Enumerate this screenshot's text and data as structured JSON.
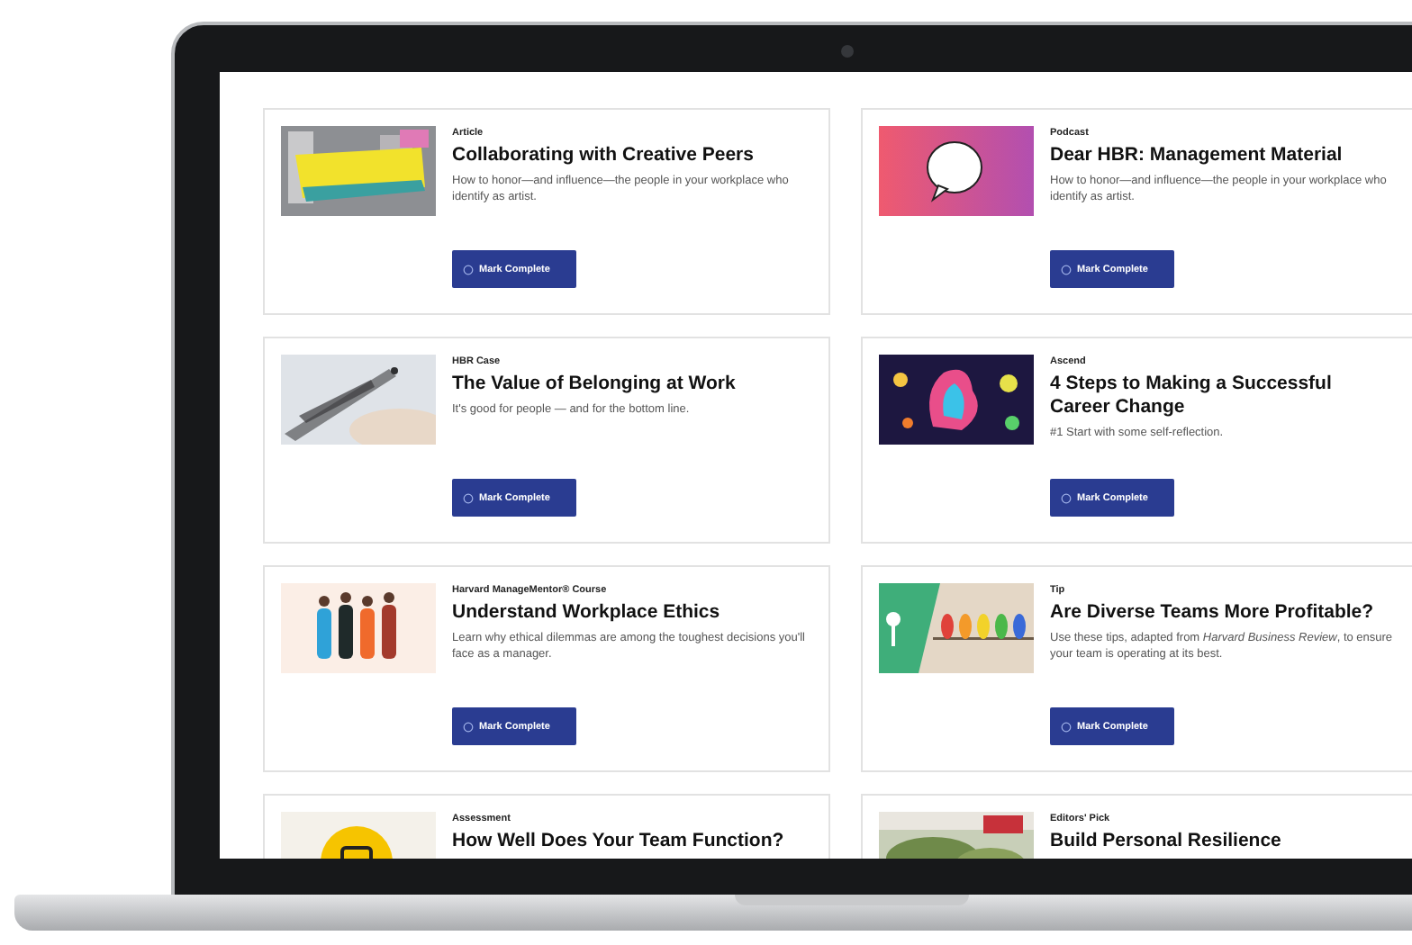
{
  "cards": [
    {
      "kind": "picture",
      "label": "Article",
      "title": "Collaborating with Creative Peers",
      "description": "How to honor—and influence—the people in your workplace who identify as artist.",
      "button": "Mark Complete"
    },
    {
      "kind": "picture",
      "label": "Podcast",
      "title": "Dear HBR: Management Material",
      "description": "How to honor—and influence—the people in your workplace who identify as artist.",
      "button": "Mark Complete"
    },
    {
      "kind": "picture",
      "label": "HBR Case",
      "title": "The Value of Belonging at Work",
      "description": "It's good for people — and for the bottom line.",
      "button": "Mark Complete"
    },
    {
      "kind": "picture",
      "label": "Ascend",
      "title": "4 Steps to Making a Successful\nCareer Change",
      "description": "#1 Start with some self-reflection.",
      "button": "Mark Complete"
    },
    {
      "kind": "picture",
      "label": "Harvard ManageMentor® Course",
      "title": "Understand Workplace Ethics",
      "description": "Learn why ethical dilemmas are among the toughest decisions you'll face as a manager.",
      "button": "Mark Complete"
    },
    {
      "kind": "picture",
      "label": "Tip",
      "title": "Are Diverse Teams More Profitable?",
      "description": "Use these tips, adapted from *Harvard Business Review*, to ensure your team is operating at its best.",
      "button": "Mark Complete"
    },
    {
      "kind": "picture",
      "label": "Assessment",
      "title": "How Well Does Your Team Function?"
    },
    {
      "kind": "picture",
      "label": "Editors' Pick",
      "title": "Build Personal Resilience"
    }
  ]
}
